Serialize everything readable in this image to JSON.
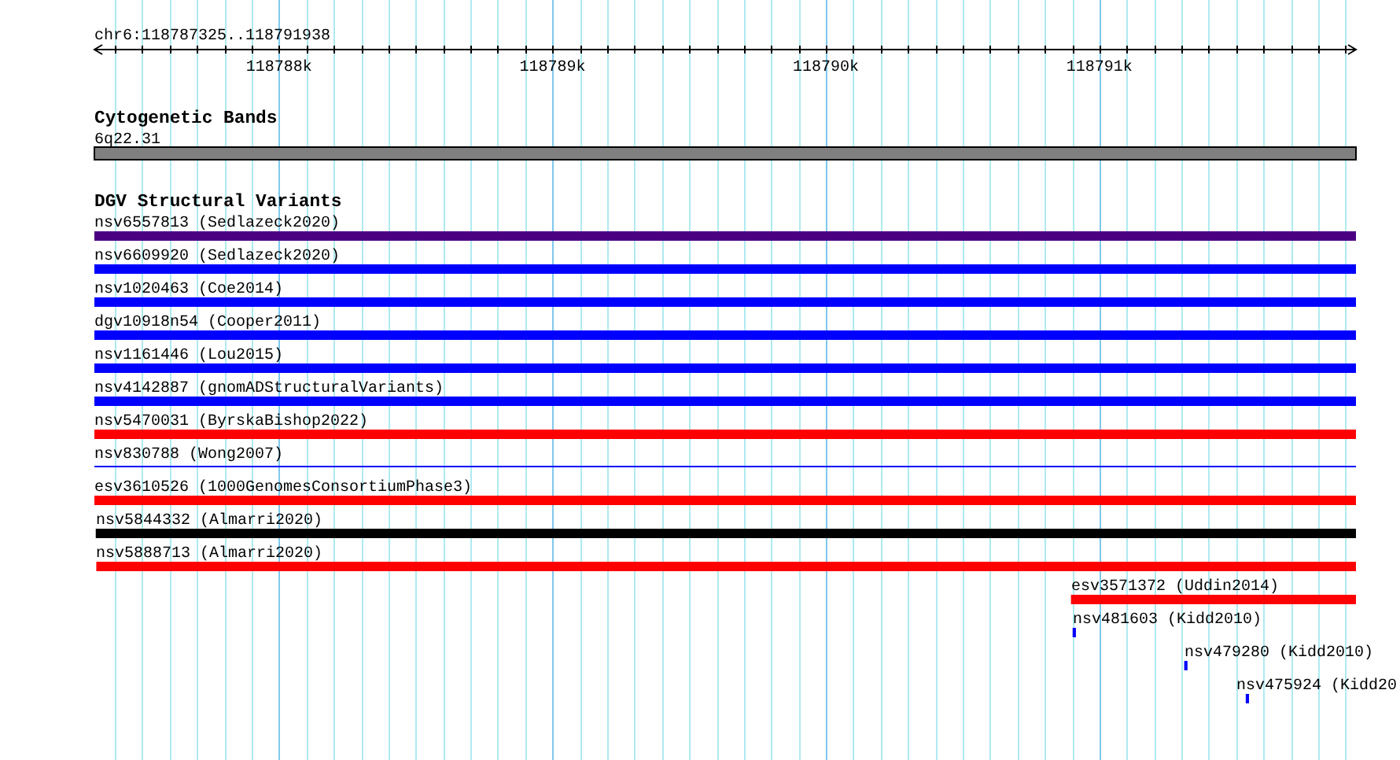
{
  "view": {
    "region": "chr6:118787325..118791938"
  },
  "ruler": {
    "ticks": [
      {
        "label": "118788k"
      },
      {
        "label": "118789k"
      },
      {
        "label": "118790k"
      },
      {
        "label": "118791k"
      }
    ]
  },
  "tracks": [
    {
      "title": "Cytogenetic Bands",
      "features": [
        {
          "kind": "band",
          "label": "6q22.31",
          "color": "#808080"
        }
      ]
    },
    {
      "title": "DGV Structural Variants",
      "features": [
        {
          "kind": "bar",
          "label": "nsv6557813 (Sedlazeck2020)",
          "color": "#4b0082"
        },
        {
          "kind": "bar",
          "label": "nsv6609920 (Sedlazeck2020)",
          "color": "#0000ff"
        },
        {
          "kind": "bar",
          "label": "nsv1020463 (Coe2014)",
          "color": "#0000ff"
        },
        {
          "kind": "bar",
          "label": "dgv10918n54 (Cooper2011)",
          "color": "#0000ff"
        },
        {
          "kind": "bar",
          "label": "nsv1161446 (Lou2015)",
          "color": "#0000ff"
        },
        {
          "kind": "bar",
          "label": "nsv4142887 (gnomADStructuralVariants)",
          "color": "#0000ff"
        },
        {
          "kind": "bar",
          "label": "nsv5470031 (ByrskaBishop2022)",
          "color": "#ff0000"
        },
        {
          "kind": "line",
          "label": "nsv830788 (Wong2007)",
          "color": "#0000ff"
        },
        {
          "kind": "bar",
          "label": "esv3610526 (1000GenomesConsortiumPhase3)",
          "color": "#ff0000"
        },
        {
          "kind": "bar",
          "label": "nsv5844332 (Almarri2020)",
          "color": "#000000"
        },
        {
          "kind": "bar",
          "label": "nsv5888713 (Almarri2020)",
          "color": "#ff0000"
        },
        {
          "kind": "bar",
          "label": "esv3571372 (Uddin2014)",
          "color": "#ff0000"
        },
        {
          "kind": "bar",
          "label": "nsv481603 (Kidd2010)",
          "color": "#0000ff"
        },
        {
          "kind": "bar",
          "label": "nsv479280 (Kidd2010)",
          "color": "#0000ff"
        },
        {
          "kind": "bar",
          "label": "nsv475924 (Kidd20",
          "color": "#0000ff"
        }
      ]
    }
  ]
}
